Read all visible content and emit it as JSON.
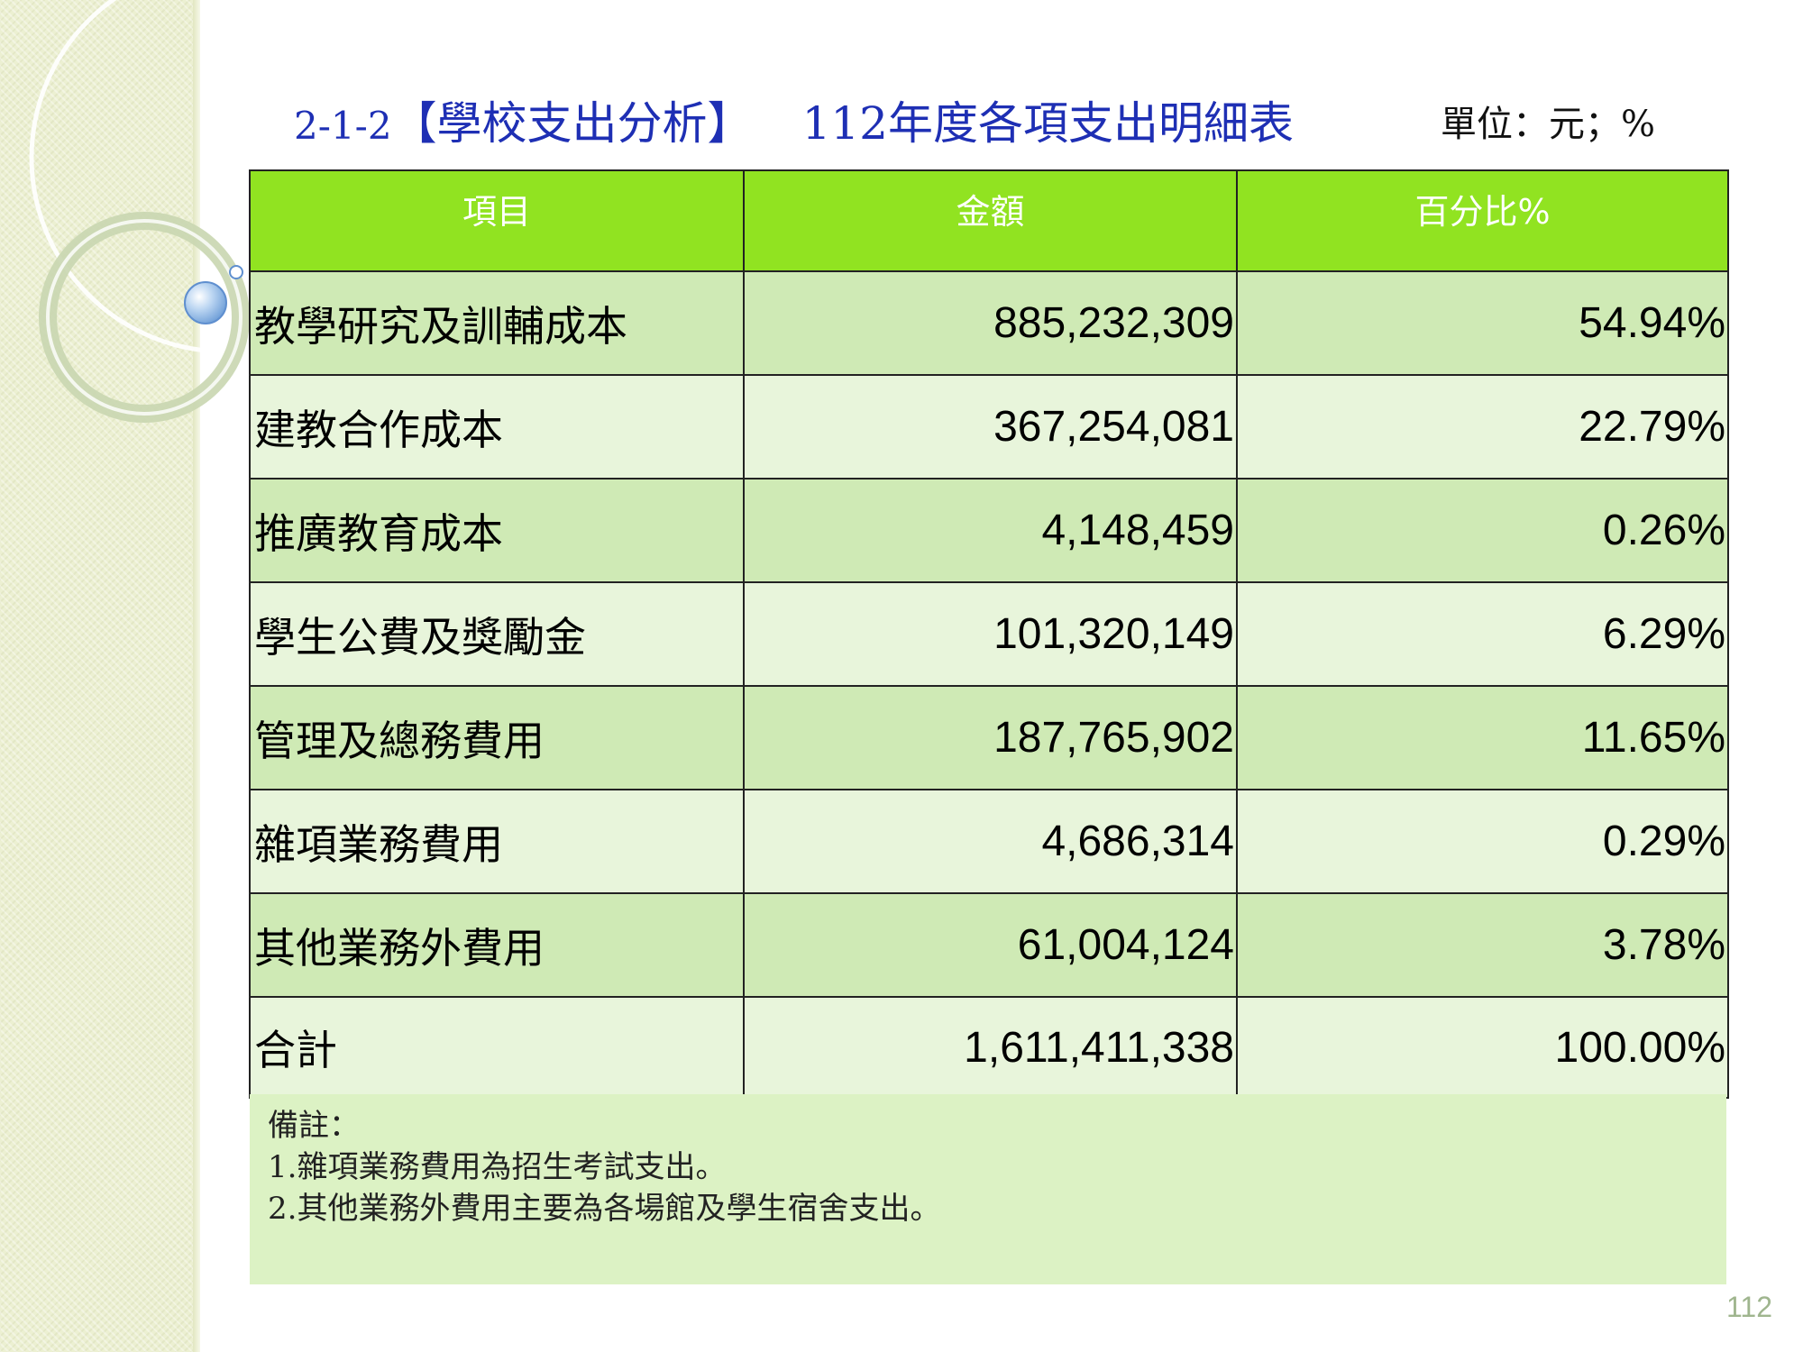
{
  "title": {
    "code": "2-1-2",
    "section": "【學校支出分析】",
    "name": "112年度各項支出明細表"
  },
  "unit_label": "單位：元；%",
  "table": {
    "headers": [
      "項目",
      "金額",
      "百分比%"
    ],
    "rows": [
      {
        "item": "教學研究及訓輔成本",
        "amount": "885,232,309",
        "percent": "54.94%"
      },
      {
        "item": "建教合作成本",
        "amount": "367,254,081",
        "percent": "22.79%"
      },
      {
        "item": "推廣教育成本",
        "amount": "4,148,459",
        "percent": "0.26%"
      },
      {
        "item": "學生公費及獎勵金",
        "amount": "101,320,149",
        "percent": "6.29%"
      },
      {
        "item": "管理及總務費用",
        "amount": "187,765,902",
        "percent": "11.65%"
      },
      {
        "item": "雜項業務費用",
        "amount": "4,686,314",
        "percent": "0.29%"
      },
      {
        "item": "其他業務外費用",
        "amount": "61,004,124",
        "percent": "3.78%"
      }
    ],
    "total": {
      "item": "合計",
      "amount": "1,611,411,338",
      "percent": "100.00%"
    }
  },
  "notes": {
    "heading": "備註：",
    "lines": [
      "1.雜項業務費用為招生考試支出。",
      "2.其他業務外費用主要為各場館及學生宿舍支出。"
    ]
  },
  "page_number": "112",
  "colors": {
    "title": "#1e2fb4",
    "header_bg": "#91e321",
    "row_dark": "#cfeab5",
    "row_light": "#e8f5db",
    "notes_bg": "#dcf2c4"
  }
}
